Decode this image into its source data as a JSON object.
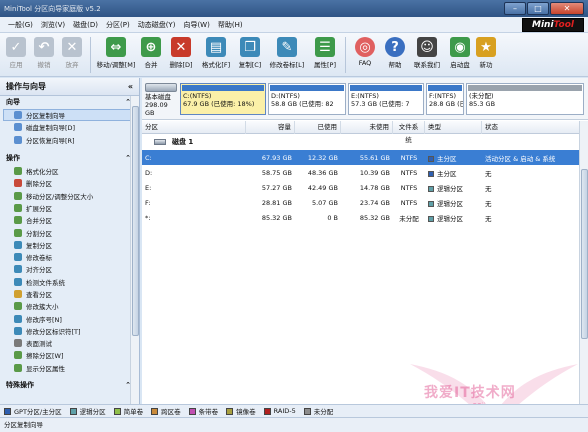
{
  "window": {
    "title": "MiniTool 分区向导家庭版 v5.2"
  },
  "logo": {
    "part1": "Mini",
    "part2": "Tool"
  },
  "menu": [
    "一般(G)",
    "浏览(V)",
    "磁盘(D)",
    "分区(P)",
    "动态磁盘(Y)",
    "向导(W)",
    "帮助(H)"
  ],
  "toolbar": [
    {
      "label": "应用",
      "icon": "check-icon",
      "enabled": false
    },
    {
      "label": "撤销",
      "icon": "undo-icon",
      "enabled": false
    },
    {
      "label": "放弃",
      "icon": "discard-icon",
      "enabled": false
    },
    {
      "label": "移动/调整[M]",
      "icon": "move-resize-icon",
      "enabled": true
    },
    {
      "label": "合并",
      "icon": "merge-icon",
      "enabled": true
    },
    {
      "label": "删除[D]",
      "icon": "delete-icon",
      "enabled": true
    },
    {
      "label": "格式化[F]",
      "icon": "format-icon",
      "enabled": true
    },
    {
      "label": "复制[C]",
      "icon": "copy-icon",
      "enabled": true
    },
    {
      "label": "修改卷标[L]",
      "icon": "label-icon",
      "enabled": true
    },
    {
      "label": "属性[P]",
      "icon": "properties-icon",
      "enabled": true
    },
    {
      "label": "FAQ",
      "icon": "lifebuoy-icon",
      "enabled": true
    },
    {
      "label": "帮助",
      "icon": "help-icon",
      "enabled": true
    },
    {
      "label": "联系我们",
      "icon": "contact-icon",
      "enabled": true
    },
    {
      "label": "启动盘",
      "icon": "boot-disk-icon",
      "enabled": true
    },
    {
      "label": "新功",
      "icon": "new-feature-icon",
      "enabled": true
    }
  ],
  "sidebar": {
    "header": "操作与向导",
    "wizard_title": "向导",
    "wizard_items": [
      "分区复制向导",
      "磁盘复制向导[D]",
      "分区恢复向导[R]"
    ],
    "ops_title": "操作",
    "ops_items": [
      "格式化分区",
      "删除分区",
      "移动分区/调整分区大小",
      "扩展分区",
      "合并分区",
      "分割分区",
      "复制分区",
      "修改卷标",
      "对齐分区",
      "检测文件系统",
      "查看分区",
      "修改簇大小",
      "修改序号[N]",
      "修改分区标识符[T]",
      "表面测试",
      "擦除分区[W]",
      "显示分区属性"
    ],
    "bottom_title": "特殊操作"
  },
  "diskmap": {
    "disk_label": "基本磁盘",
    "disk_size": "298.09 GB",
    "blocks": [
      {
        "line1": "C:(NTFS)",
        "line2": "67.9 GB (已使用: 18%)",
        "bar": "#3b78c8"
      },
      {
        "line1": "D:(NTFS)",
        "line2": "58.8 GB (已使用: 82",
        "bar": "#3b78c8"
      },
      {
        "line1": "E:(NTFS)",
        "line2": "57.3 GB (已使用: 7",
        "bar": "#3b78c8"
      },
      {
        "line1": "F:(NTFS)",
        "line2": "28.8 GB (已",
        "bar": "#3b78c8"
      },
      {
        "line1": "(未分配)",
        "line2": "85.3 GB",
        "bar": "#9aa3ad"
      }
    ]
  },
  "table": {
    "headers": [
      "分区",
      "容量",
      "已使用",
      "未使用",
      "文件系统",
      "类型",
      "状态"
    ],
    "disk_row": "磁盘 1",
    "rows": [
      {
        "part": "C:",
        "cap": "67.93 GB",
        "used": "12.32 GB",
        "free": "55.61 GB",
        "fs": "NTFS",
        "type": "主分区",
        "status": "活动分区 & 启动 & 系统",
        "color": "#2f5fb0"
      },
      {
        "part": "D:",
        "cap": "58.75 GB",
        "used": "48.36 GB",
        "free": "10.39 GB",
        "fs": "NTFS",
        "type": "主分区",
        "status": "无",
        "color": "#2f5fb0"
      },
      {
        "part": "E:",
        "cap": "57.27 GB",
        "used": "42.49 GB",
        "free": "14.78 GB",
        "fs": "NTFS",
        "type": "逻辑分区",
        "status": "无",
        "color": "#5fa0a8"
      },
      {
        "part": "F:",
        "cap": "28.81 GB",
        "used": "5.07 GB",
        "free": "23.74 GB",
        "fs": "NTFS",
        "type": "逻辑分区",
        "status": "无",
        "color": "#5fa0a8"
      },
      {
        "part": "*:",
        "cap": "85.32 GB",
        "used": "0 B",
        "free": "85.32 GB",
        "fs": "未分配",
        "type": "逻辑分区",
        "status": "无",
        "color": "#5fa0a8"
      }
    ]
  },
  "legend": [
    {
      "label": "GPT分区/主分区",
      "color": "#2f5fb0"
    },
    {
      "label": "逻辑分区",
      "color": "#5fa0a8"
    },
    {
      "label": "简单卷",
      "color": "#8fbf4a"
    },
    {
      "label": "跨区卷",
      "color": "#c98a3a"
    },
    {
      "label": "条带卷",
      "color": "#c04fb0"
    },
    {
      "label": "镜像卷",
      "color": "#a8a040"
    },
    {
      "label": "RAID-5",
      "color": "#b02020"
    },
    {
      "label": "未分配",
      "color": "#8c8c8c"
    }
  ],
  "statusbar": "分区复制向导",
  "watermark": {
    "text": "我爱IT技术网",
    "url": "www.52ij.com"
  }
}
